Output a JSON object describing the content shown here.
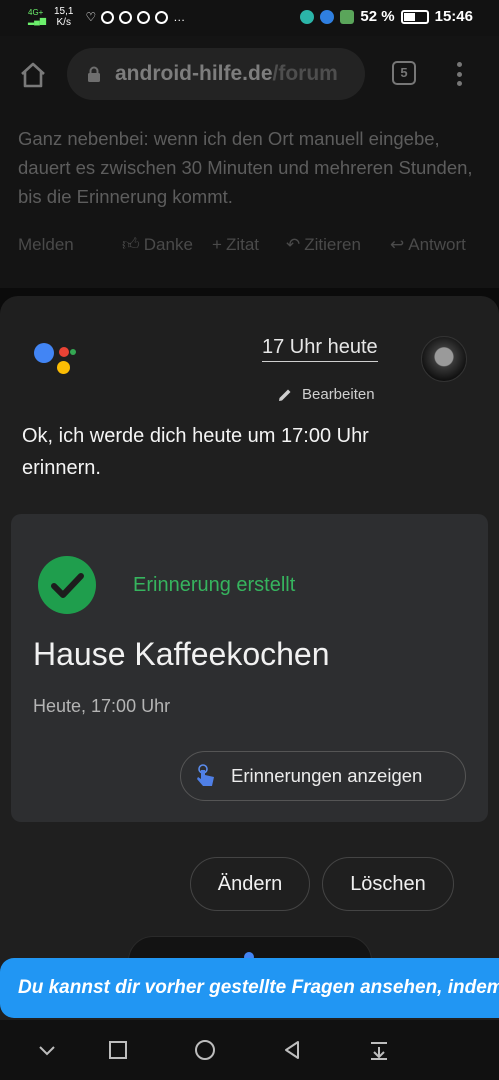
{
  "status_bar": {
    "network": "4G+",
    "speed_value": "15,1",
    "speed_unit": "K/s",
    "more": "…",
    "battery_percent": "52 %",
    "battery_level": 0.52,
    "time": "15:46"
  },
  "browser": {
    "url_host": "android-hilfe.de",
    "url_path": "/forum",
    "tab_count": "5"
  },
  "forum": {
    "post_text": "Ganz nebenbei: wenn ich den Ort manuell eingebe, dauert es zwischen 30 Minuten und mehreren Stunden, bis die Erinnerung kommt.",
    "actions": {
      "report": "Melden",
      "thanks": "Danke",
      "quote_plus": "Zitat",
      "quote": "Zitieren",
      "reply": "Antwort"
    }
  },
  "assistant": {
    "query": "17 Uhr heute",
    "edit_label": "Bearbeiten",
    "response": "Ok, ich werde dich heute um 17:00 Uhr erinnern.",
    "card": {
      "status": "Erinnerung erstellt",
      "title": "Hause Kaffeekochen",
      "date": "Heute, 17:00 Uhr",
      "show_button": "Erinnerungen anzeigen"
    },
    "chips": {
      "change": "Ändern",
      "delete": "Löschen"
    },
    "hint_banner": "Du kannst dir vorher gestellte Fragen ansehen, indem"
  },
  "colors": {
    "accent_blue": "#2196f3",
    "success_green": "#1f9e4d",
    "google_blue": "#4285f4",
    "google_red": "#ea4335",
    "google_yellow": "#fbbc04",
    "google_green": "#34a853"
  },
  "nav_icons": [
    "chevron-down-icon",
    "recent-apps-icon",
    "home-circle-icon",
    "back-icon",
    "notification-pull-icon"
  ]
}
